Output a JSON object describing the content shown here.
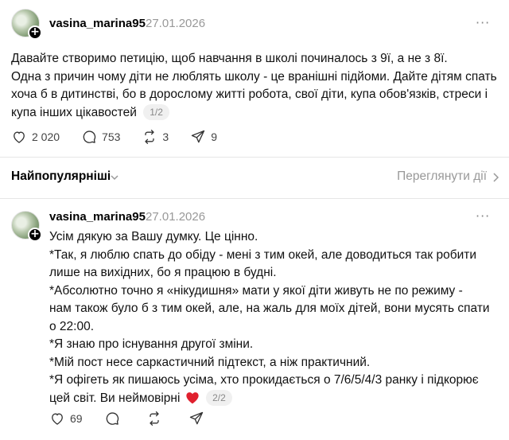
{
  "post": {
    "username": "vasina_marina95",
    "date": "27.01.2026",
    "more_label": "···",
    "lines": [
      "Давайте створимо петицію, щоб навчання в школі починалось з 9ї, а не з 8ї.",
      "Одна з причин чому діти не люблять школу - це вранішні підйоми. Дайте дітям спать",
      "хоча б в дитинстві, бо в дорослому житті робота, свої діти, купа обов'язків, стреси і",
      "купа інших цікавостей"
    ],
    "counter": "1/2",
    "likes": "2 020",
    "comments": "753",
    "reposts": "3",
    "shares": "9"
  },
  "sort": {
    "label": "Найпопулярніші",
    "activity_label": "Переглянути дії"
  },
  "reply": {
    "username": "vasina_marina95",
    "date": "27.01.2026",
    "more_label": "···",
    "lines": [
      "Усім дякую за Вашу думку. Це цінно.",
      "*Так, я люблю спать до обіду - мені з тим окей, але доводиться так робити",
      "лише на вихідних, бо я працюю в будні.",
      "*Абсолютно точно я «нікудишня» мати у якої діти живуть не по режиму -",
      "нам також було б з тим окей, але, на жаль для моїх дітей, вони мусять спати",
      "о 22:00.",
      "*Я знаю про існування другої зміни.",
      "*Мій пост несе саркастичний підтекст, а ніж практичний.",
      "*Я офігеть як пишаюсь усіма, хто прокидається о 7/6/5/4/3 ранку і підкорює",
      "цей світ. Ви неймовірні"
    ],
    "counter": "2/2",
    "likes": "69"
  },
  "colors": {
    "heart_emoji": "#e0202e",
    "muted": "#999999"
  }
}
